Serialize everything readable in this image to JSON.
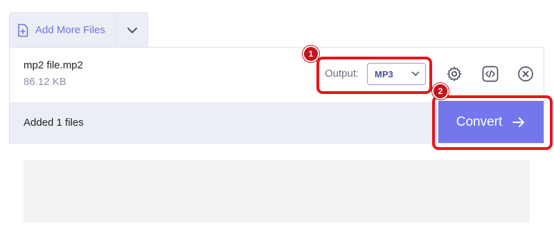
{
  "toolbar": {
    "add_more_label": "Add More Files",
    "add_more_icon": "file-plus-icon",
    "dropdown_icon": "chevron-down-icon"
  },
  "file": {
    "name": "mp2 file.mp2",
    "size": "86.12 KB"
  },
  "output": {
    "label": "Output:",
    "selected": "MP3"
  },
  "actions": {
    "settings_icon": "gear-icon",
    "embed_icon": "code-icon",
    "remove_icon": "close-circle-icon"
  },
  "status": {
    "added_text": "Added 1 files"
  },
  "convert": {
    "label": "Convert",
    "icon": "arrow-right-icon"
  },
  "annotations": {
    "badge_1": "1",
    "badge_2": "2"
  },
  "colors": {
    "accent": "#7477ec",
    "highlight": "#e8141b",
    "panel_bg": "#ebeef5"
  }
}
